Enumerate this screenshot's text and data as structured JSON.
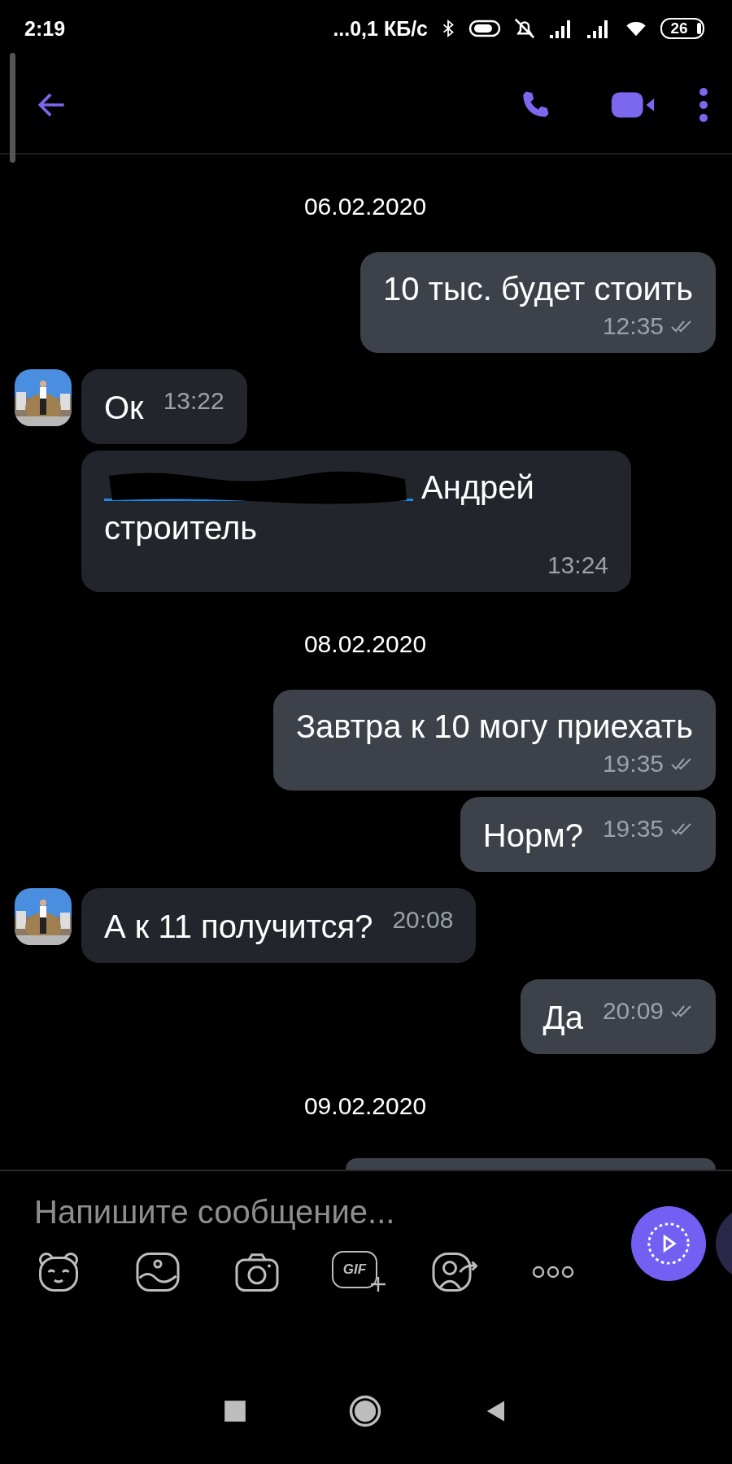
{
  "status_bar": {
    "time": "2:19",
    "speed": "...0,1 КБ/с",
    "battery": "26"
  },
  "messages": [
    {
      "kind": "date",
      "text": "06.02.2020"
    },
    {
      "kind": "out",
      "text": "10 тыс. будет стоить",
      "time": "12:35",
      "seen": true
    },
    {
      "kind": "in",
      "show_avatar": true,
      "text": "Ок",
      "time": "13:22"
    },
    {
      "kind": "in_redacted",
      "show_avatar": false,
      "text": "Андрей строитель",
      "time": "13:24"
    },
    {
      "kind": "date",
      "text": "08.02.2020"
    },
    {
      "kind": "out",
      "text": "Завтра к 10 могу приехать",
      "time": "19:35",
      "seen": true
    },
    {
      "kind": "out",
      "text": "Норм?",
      "time": "19:35",
      "seen": true
    },
    {
      "kind": "in",
      "show_avatar": true,
      "text": "А к 11 получится?",
      "time": "20:08"
    },
    {
      "kind": "out",
      "text": "Да",
      "time": "20:09",
      "seen": true
    },
    {
      "kind": "date",
      "text": "09.02.2020"
    },
    {
      "kind": "partial"
    }
  ],
  "composer": {
    "placeholder": "Напишите сообщение...",
    "gif_label": "GIF"
  }
}
